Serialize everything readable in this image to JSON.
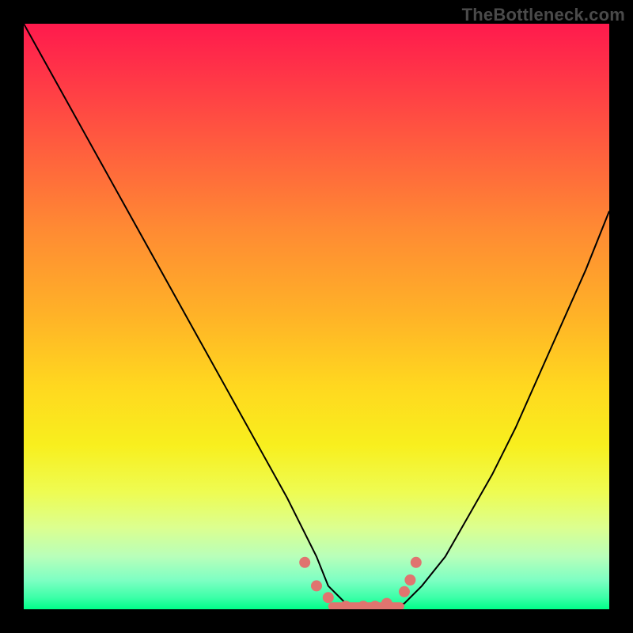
{
  "watermark": "TheBottleneck.com",
  "colors": {
    "frame": "#000000",
    "curve": "#000000",
    "marker": "#e0746f",
    "gradient_top": "#ff1a4d",
    "gradient_bottom": "#00ff88"
  },
  "chart_data": {
    "type": "line",
    "title": "",
    "xlabel": "",
    "ylabel": "",
    "xlim": [
      0,
      100
    ],
    "ylim": [
      0,
      100
    ],
    "legend": false,
    "grid": false,
    "note": "Axes are unlabeled; values estimated from pixel geometry. y=0 corresponds to the green bottom band (no bottleneck), y=100 to the top.",
    "series": [
      {
        "name": "bottleneck-curve",
        "x": [
          0,
          5,
          10,
          15,
          20,
          25,
          30,
          35,
          40,
          45,
          50,
          52,
          55,
          58,
          62,
          65,
          68,
          72,
          76,
          80,
          84,
          88,
          92,
          96,
          100
        ],
        "y": [
          100,
          91,
          82,
          73,
          64,
          55,
          46,
          37,
          28,
          19,
          9,
          4,
          1,
          0,
          0,
          1,
          4,
          9,
          16,
          23,
          31,
          40,
          49,
          58,
          68
        ]
      }
    ],
    "markers": {
      "name": "highlighted-points",
      "x": [
        48,
        50,
        52,
        55,
        58,
        60,
        62,
        65,
        66,
        67
      ],
      "y": [
        8,
        4,
        2,
        0.5,
        0.5,
        0.5,
        1,
        3,
        5,
        8
      ]
    },
    "flat_bar": {
      "x_start": 52,
      "x_end": 65,
      "y": 0.5
    }
  }
}
